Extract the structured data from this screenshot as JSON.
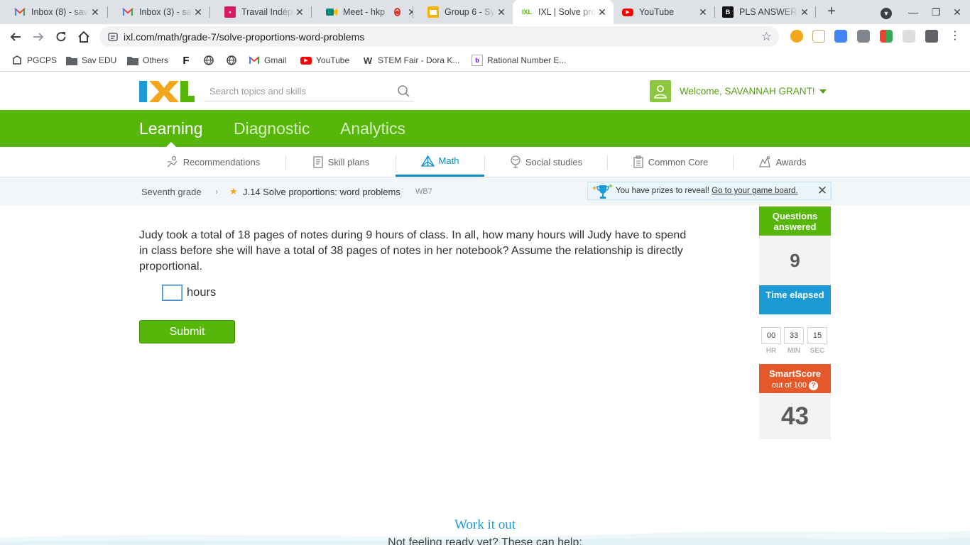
{
  "browser": {
    "tabs": [
      {
        "title": "Inbox (8) - sav",
        "icon": "gmail-icon",
        "color": "#ea4335"
      },
      {
        "title": "Inbox (3) - sav",
        "icon": "gmail-icon",
        "color": "#ea4335"
      },
      {
        "title": "Travail Indépe",
        "icon": "classroom-icon",
        "color": "#d81b60"
      },
      {
        "title": "Meet - hkp",
        "icon": "meet-icon",
        "color": "#00897b"
      },
      {
        "title": "Group 6 - Sym",
        "icon": "slides-icon",
        "color": "#f4b400"
      },
      {
        "title": "IXL | Solve pro",
        "icon": "ixl-icon",
        "color": "#56b70a"
      },
      {
        "title": "YouTube",
        "icon": "youtube-icon",
        "color": "#ff0000"
      },
      {
        "title": "PLS ANSWER",
        "icon": "brainly-icon",
        "color": "#111111"
      }
    ],
    "url": "ixl.com/math/grade-7/solve-proportions-word-problems",
    "bookmarks": [
      {
        "label": "PGCPS",
        "icon": "pgcps-icon"
      },
      {
        "label": "Sav EDU",
        "icon": "folder-icon"
      },
      {
        "label": "Others",
        "icon": "folder-icon"
      },
      {
        "label": "",
        "icon": "flocabulary-icon"
      },
      {
        "label": "",
        "icon": "globe-icon"
      },
      {
        "label": "",
        "icon": "globe-icon"
      },
      {
        "label": "Gmail",
        "icon": "gmail-icon"
      },
      {
        "label": "YouTube",
        "icon": "youtube-icon"
      },
      {
        "label": "STEM Fair - Dora K...",
        "icon": "weebly-icon"
      },
      {
        "label": "Rational Number E...",
        "icon": "yahoo-icon"
      }
    ]
  },
  "header": {
    "logo": "IXL",
    "search_placeholder": "Search topics and skills",
    "welcome": "Welcome, SAVANNAH GRANT!"
  },
  "main_nav": [
    "Learning",
    "Diagnostic",
    "Analytics"
  ],
  "sub_nav": [
    {
      "label": "Recommendations",
      "icon": "recommendations-icon"
    },
    {
      "label": "Skill plans",
      "icon": "skill-plans-icon"
    },
    {
      "label": "Math",
      "icon": "math-icon",
      "active": true
    },
    {
      "label": "Social studies",
      "icon": "social-studies-icon"
    },
    {
      "label": "Common Core",
      "icon": "common-core-icon"
    },
    {
      "label": "Awards",
      "icon": "awards-icon"
    }
  ],
  "breadcrumb": {
    "grade": "Seventh grade",
    "skill": "J.14 Solve proportions: word problems",
    "code": "WB7"
  },
  "prize": {
    "message": "You have prizes to reveal!",
    "link": "Go to your game board."
  },
  "question": {
    "text": "Judy took a total of 18 pages of notes during 9 hours of class. In all, how many hours will Judy have to spend in class before she will have a total of 38 pages of notes in her notebook? Assume the relationship is directly proportional.",
    "answer_value": "",
    "unit": "hours",
    "submit_label": "Submit"
  },
  "stats": {
    "questions_label": "Questions answered",
    "questions_value": "9",
    "time_label": "Time elapsed",
    "time": {
      "hr": "00",
      "min": "33",
      "sec": "15"
    },
    "time_units": {
      "hr": "HR",
      "min": "MIN",
      "sec": "SEC"
    },
    "smartscore_label": "SmartScore",
    "smartscore_sub": "out of 100",
    "smartscore_value": "43",
    "colors": {
      "questions": "#56b70a",
      "time": "#1b9ad6",
      "smartscore": "#e4582a"
    }
  },
  "help": {
    "title": "Work it out",
    "subtitle": "Not feeling ready yet? These can help:"
  }
}
